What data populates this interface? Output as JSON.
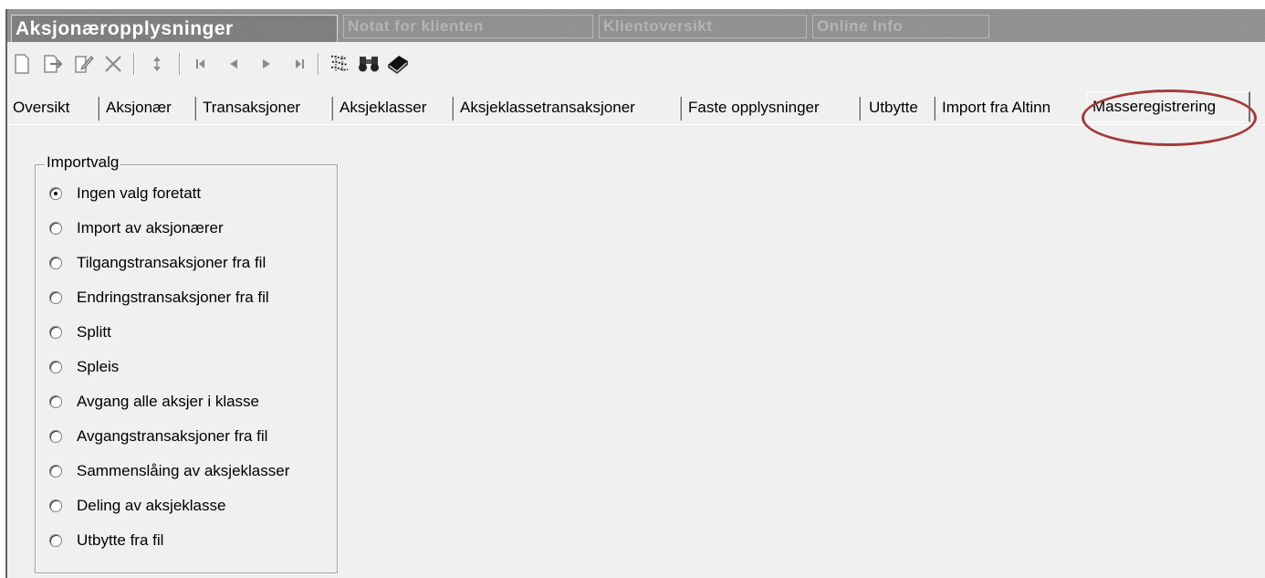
{
  "window_tabs": [
    {
      "label": "Aksjonæropplysninger",
      "active": true
    },
    {
      "label": "Notat for klienten",
      "active": false
    },
    {
      "label": "Klientoversikt",
      "active": false
    },
    {
      "label": "Online Info",
      "active": false
    }
  ],
  "toolbar": {
    "icons": [
      "new-document-icon",
      "export-icon",
      "edit-icon",
      "delete-icon",
      "refresh-icon",
      "first-record-icon",
      "previous-record-icon",
      "next-record-icon",
      "last-record-icon",
      "map-icon",
      "binoculars-icon",
      "book-icon"
    ]
  },
  "tabs": [
    {
      "label": "Oversikt"
    },
    {
      "label": "Aksjonær"
    },
    {
      "label": "Transaksjoner"
    },
    {
      "label": "Aksjeklasser"
    },
    {
      "label": "Aksjeklassetransaksjoner"
    },
    {
      "label": "Faste opplysninger"
    },
    {
      "label": "Utbytte"
    },
    {
      "label": "Import fra Altinn"
    },
    {
      "label": "Masseregistrering",
      "selected": true
    }
  ],
  "importvalg": {
    "title": "Importvalg",
    "options": [
      {
        "label": "Ingen valg foretatt",
        "checked": true
      },
      {
        "label": "Import av aksjonærer",
        "checked": false
      },
      {
        "label": "Tilgangstransaksjoner fra fil",
        "checked": false
      },
      {
        "label": "Endringstransaksjoner fra fil",
        "checked": false
      },
      {
        "label": "Splitt",
        "checked": false
      },
      {
        "label": "Spleis",
        "checked": false
      },
      {
        "label": "Avgang alle aksjer i klasse",
        "checked": false
      },
      {
        "label": "Avgangstransaksjoner fra fil",
        "checked": false
      },
      {
        "label": "Sammenslåing av aksjeklasser",
        "checked": false
      },
      {
        "label": "Deling av aksjeklasse",
        "checked": false
      },
      {
        "label": "Utbytte fra fil",
        "checked": false
      }
    ]
  },
  "colors": {
    "highlight_oval": "#a23b3b",
    "title_bar": "#8f8f8f",
    "background": "#f0f0f0"
  }
}
